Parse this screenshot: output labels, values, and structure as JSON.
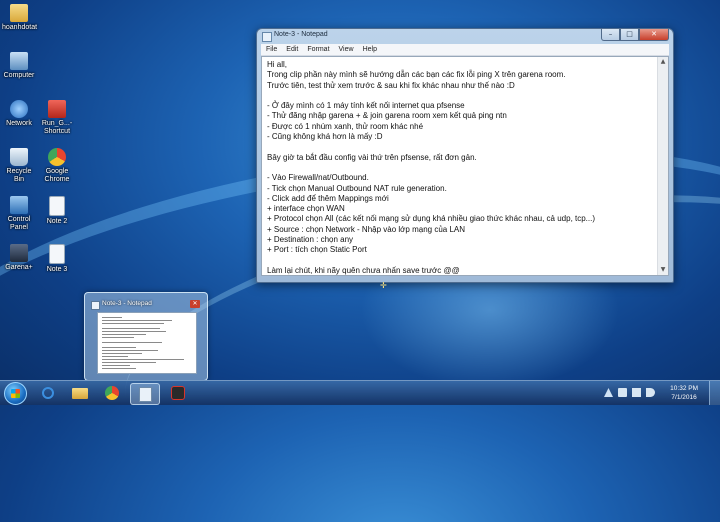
{
  "desktop": {
    "icons": [
      {
        "label": "hoanhdotat",
        "icon": "user-folder-icon",
        "color": "#e7c468"
      },
      {
        "label": "Computer",
        "icon": "computer-icon",
        "color": "#8fb6dc"
      },
      {
        "label": "Network",
        "icon": "network-icon",
        "color": "#6aa6e0"
      },
      {
        "label": "Run_G...- Shortcut",
        "icon": "shortcut-icon",
        "color": "#d84a3a"
      },
      {
        "label": "Recycle Bin",
        "icon": "recycle-bin-icon",
        "color": "#cfe0ee"
      },
      {
        "label": "Google Chrome",
        "icon": "chrome-icon",
        "color": "#e7452e"
      },
      {
        "label": "Control Panel",
        "icon": "control-panel-icon",
        "color": "#4f8fd0"
      },
      {
        "label": "Note 2",
        "icon": "text-file-icon",
        "color": "#f2f5f8"
      },
      {
        "label": "Garena+",
        "icon": "garena-icon",
        "color": "#2e3e56"
      },
      {
        "label": "Note 3",
        "icon": "text-file-icon",
        "color": "#f2f5f8"
      }
    ]
  },
  "notepad": {
    "title": "Note-3 - Notepad",
    "menu": [
      "File",
      "Edit",
      "Format",
      "View",
      "Help"
    ],
    "controls": {
      "minimize": "–",
      "maximize": "□",
      "close": "✕"
    },
    "content": "Hi all,\nTrong clip phần này mình sẽ hướng dẫn các bạn các fix lỗi ping X trên garena room.\nTrước tiên, test thử xem trước & sau khi fix khác nhau như thế nào :D\n\n- Ở đây mình có 1 máy tính kết nối internet qua pfsense\n- Thử đăng nhập garena + & join garena room xem kết quả ping ntn\n- Được có 1 nhúm xanh, thử room khác nhé\n- Cũng không khá hơn là mấy :D\n\nBây giờ ta bắt đầu config vài thứ trên pfsense, rất đơn gản.\n\n- Vào Firewall/nat/Outbound.\n- Tick chọn Manual Outbound NAT rule generation.\n- Click add để thêm Mappings mới\n+ interface chọn WAN\n+ Protocol chọn All (các kết nối mạng sử dụng khá nhiều giao thức khác nhau, cả udp, tcp...)\n+ Source : chọn Network - Nhập vào lớp mạng của LAN\n+ Destination : chọn any\n+ Port : tích chọn Static Port\n\nLàm lại chút, khi nãy quên chưa nhấn save trước @@"
  },
  "thumbnail": {
    "title": "Note-3 - Notepad",
    "close": "✕"
  },
  "taskbar": {
    "buttons": [
      {
        "name": "ie",
        "icon": "internet-explorer-icon",
        "color": "#3b8fe0"
      },
      {
        "name": "explorer",
        "icon": "folder-icon",
        "color": "#e8c15a"
      },
      {
        "name": "chrome",
        "icon": "chrome-icon",
        "color": "#e7452e"
      },
      {
        "name": "notepad",
        "icon": "notepad-icon",
        "color": "#dfe9f3"
      },
      {
        "name": "garena",
        "icon": "garena-icon",
        "color": "#2a2a2a"
      }
    ],
    "clock": {
      "time": "10:32 PM",
      "date": "7/1/2016"
    }
  }
}
